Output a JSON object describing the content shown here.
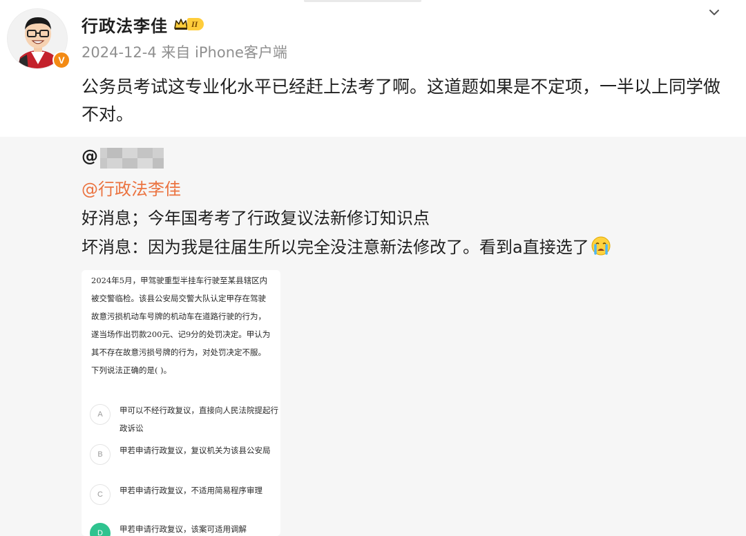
{
  "post": {
    "username": "行政法李佳",
    "vip_level": "II",
    "date": "2024-12-4",
    "source": "来自 iPhone客户端",
    "text": "公务员考试这专业化水平已经赶上法考了啊。这道题如果是不定项，一半以上同学做不对。"
  },
  "repost": {
    "author_prefix": "@",
    "mention": "@行政法李佳",
    "line1": "好消息；今年国考考了行政复议法新修订知识点",
    "line2": "坏消息：因为我是往届生所以完全没注意新法修改了。看到a直接选了"
  },
  "quiz": {
    "question": "2024年5月，甲驾驶重型半挂车行驶至某县辖区内被交警临检。该县公安局交警大队认定甲存在驾驶故意污损机动车号牌的机动车在道路行驶的行为，遂当场作出罚款200元、记9分的处罚决定。甲认为其不存在故意污损号牌的行为，对处罚决定不服。下列说法正确的是(    )。",
    "options": [
      {
        "letter": "A",
        "text": "甲可以不经行政复议，直接向人民法院提起行政诉讼"
      },
      {
        "letter": "B",
        "text": "甲若申请行政复议，复议机关为该县公安局"
      },
      {
        "letter": "C",
        "text": "甲若申请行政复议，不适用简易程序审理"
      },
      {
        "letter": "D",
        "text": "甲若申请行政复议，该案可适用调解"
      }
    ]
  },
  "icons": {
    "chevron": "chevron-down-icon",
    "vip": "crown-icon",
    "verified": "verified-v-icon",
    "emoji": "crying-emoji-icon"
  },
  "colors": {
    "mention": "#eb7340",
    "verified": "#f38a14",
    "vip": "#ffcd3b",
    "selected_option": "#2fc38f",
    "repost_bg": "#f6f6f6"
  }
}
